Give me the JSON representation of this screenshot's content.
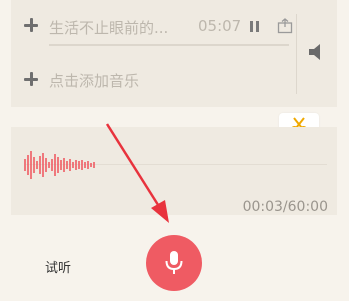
{
  "music": {
    "track_title": "生活不止眼前的...",
    "track_time": "05:07",
    "add_music_label": "点击添加音乐"
  },
  "recording": {
    "counter": "00:03/60:00"
  },
  "controls": {
    "listen_label": "试听"
  },
  "icons": {
    "add": "plus-icon",
    "pause": "pause-icon",
    "export": "export-icon",
    "volume": "speaker-icon",
    "trim": "scissors-icon",
    "record": "microphone-icon"
  },
  "colors": {
    "accent": "#ef5b63",
    "trim_icon": "#f0a800",
    "panel": "#efeae1",
    "background": "#f7f3ec",
    "annotation_arrow": "#e8333d"
  }
}
